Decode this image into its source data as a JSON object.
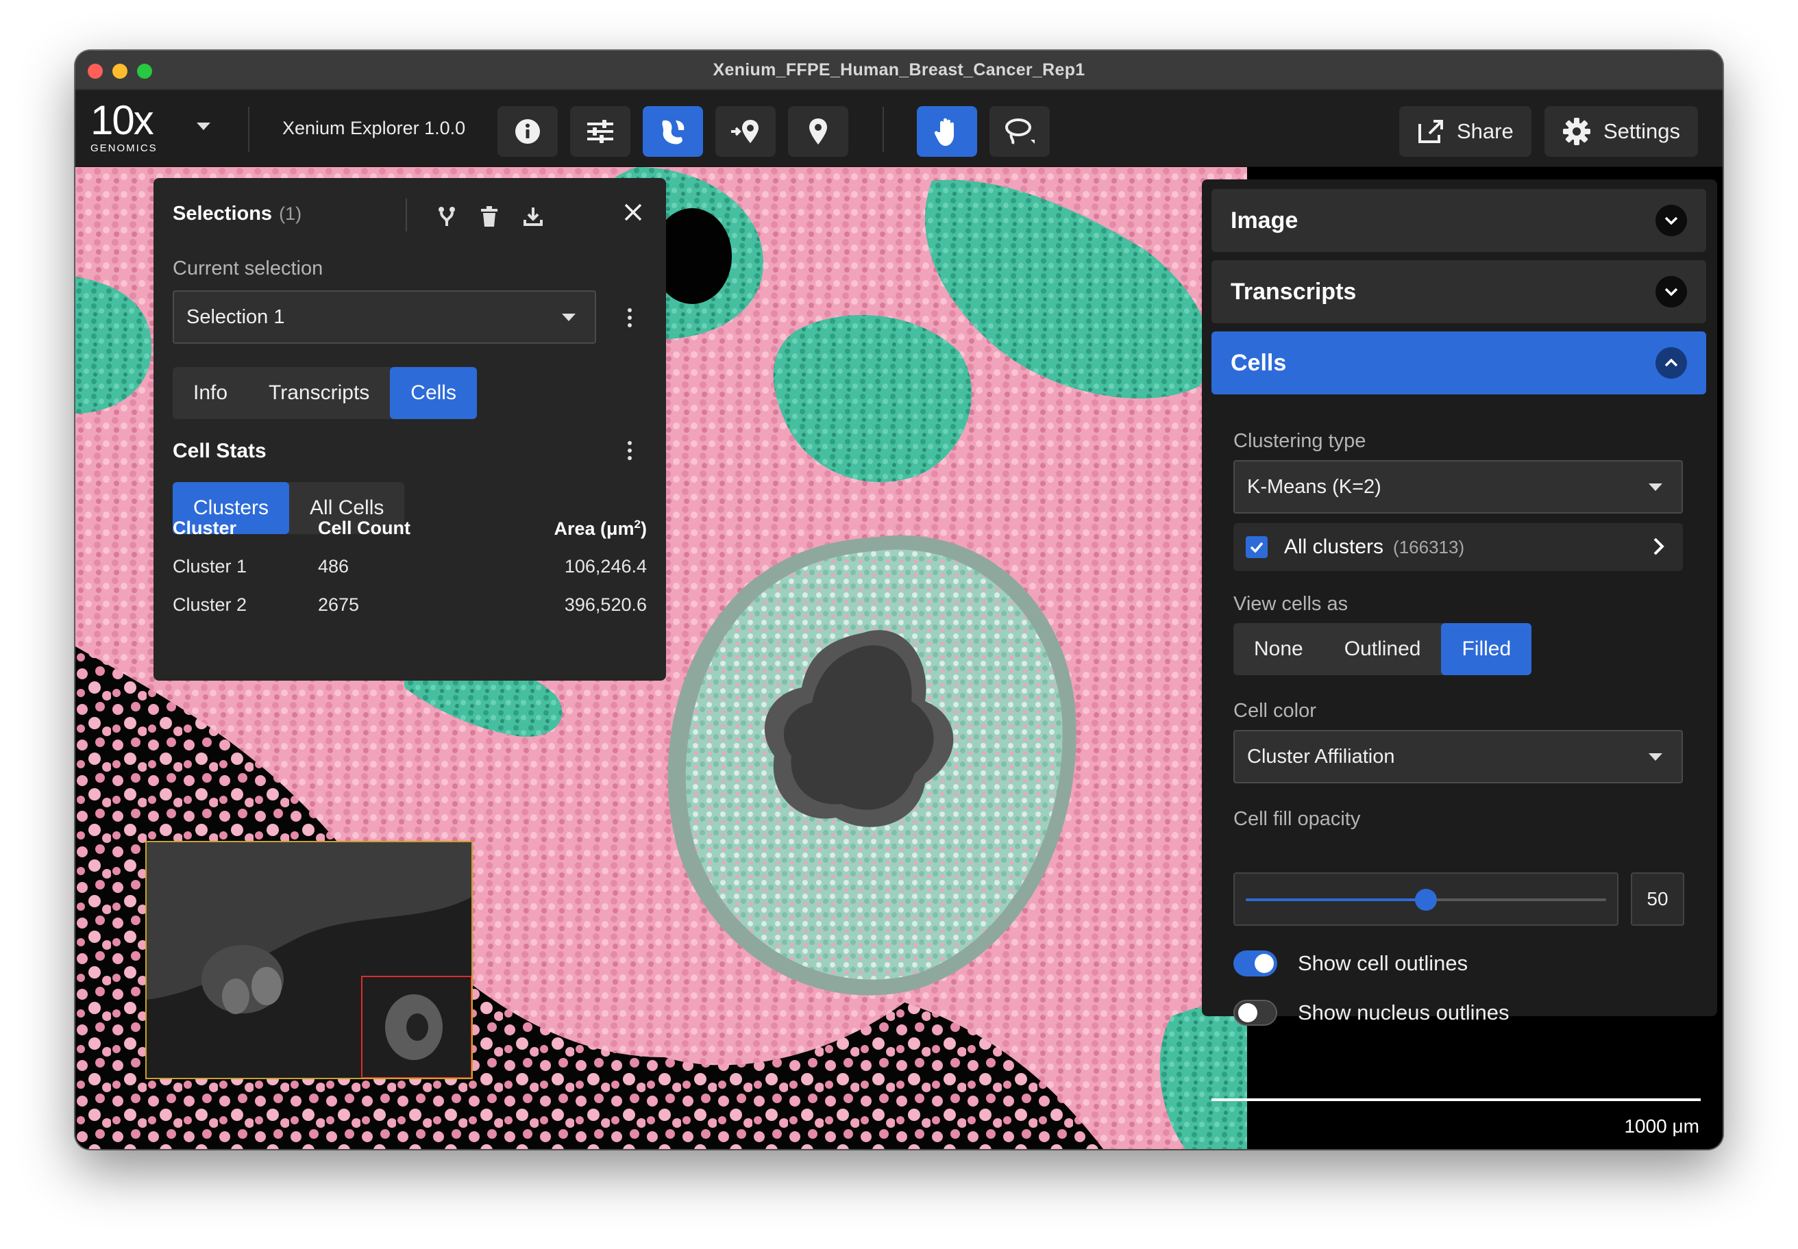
{
  "window": {
    "title": "Xenium_FFPE_Human_Breast_Cancer_Rep1"
  },
  "toolbar": {
    "logo_main": "10x",
    "logo_sub": "GENOMICS",
    "app_version": "Xenium Explorer 1.0.0",
    "share_label": "Share",
    "settings_label": "Settings",
    "tools": [
      "info-icon",
      "sliders-icon",
      "cell-selection-icon",
      "add-pin-icon",
      "pin-icon",
      "pan-hand-icon",
      "lasso-icon"
    ],
    "accent_color": "#2d6bd9"
  },
  "selections_panel": {
    "title": "Selections",
    "count": "(1)",
    "current_selection_label": "Current selection",
    "current_selection_value": "Selection 1",
    "tabs": [
      {
        "label": "Info",
        "active": false
      },
      {
        "label": "Transcripts",
        "active": false
      },
      {
        "label": "Cells",
        "active": true
      }
    ],
    "cell_stats_title": "Cell Stats",
    "stats_tabs": [
      {
        "label": "Clusters",
        "active": true
      },
      {
        "label": "All Cells",
        "active": false
      }
    ],
    "table": {
      "headers": [
        "Cluster",
        "Cell Count",
        "Area (μm"
      ],
      "header_area_sup": "2",
      "header_area_close": ")",
      "rows": [
        [
          "Cluster 1",
          "486",
          "106,246.4"
        ],
        [
          "Cluster 2",
          "2675",
          "396,520.6"
        ]
      ]
    }
  },
  "right_panel": {
    "sections": [
      {
        "label": "Image",
        "open": false
      },
      {
        "label": "Transcripts",
        "open": false
      },
      {
        "label": "Cells",
        "open": true
      }
    ],
    "clustering_type_label": "Clustering type",
    "clustering_type_value": "K-Means (K=2)",
    "all_clusters_label": "All clusters",
    "all_clusters_count": "(166313)",
    "view_cells_label": "View cells as",
    "view_cells_options": [
      {
        "label": "None",
        "active": false
      },
      {
        "label": "Outlined",
        "active": false
      },
      {
        "label": "Filled",
        "active": true
      }
    ],
    "cell_color_label": "Cell color",
    "cell_color_value": "Cluster Affiliation",
    "cell_fill_opacity_label": "Cell fill opacity",
    "cell_fill_opacity_value": "50",
    "cell_fill_opacity_fraction": 0.5,
    "show_cell_outlines_label": "Show cell outlines",
    "show_cell_outlines_on": true,
    "show_nucleus_outlines_label": "Show nucleus outlines",
    "show_nucleus_outlines_on": false
  },
  "viewer": {
    "scale_label": "1000 μm",
    "cluster_colors": {
      "cluster_1": "#4fc3a6",
      "cluster_2": "#f2a6bd"
    }
  }
}
